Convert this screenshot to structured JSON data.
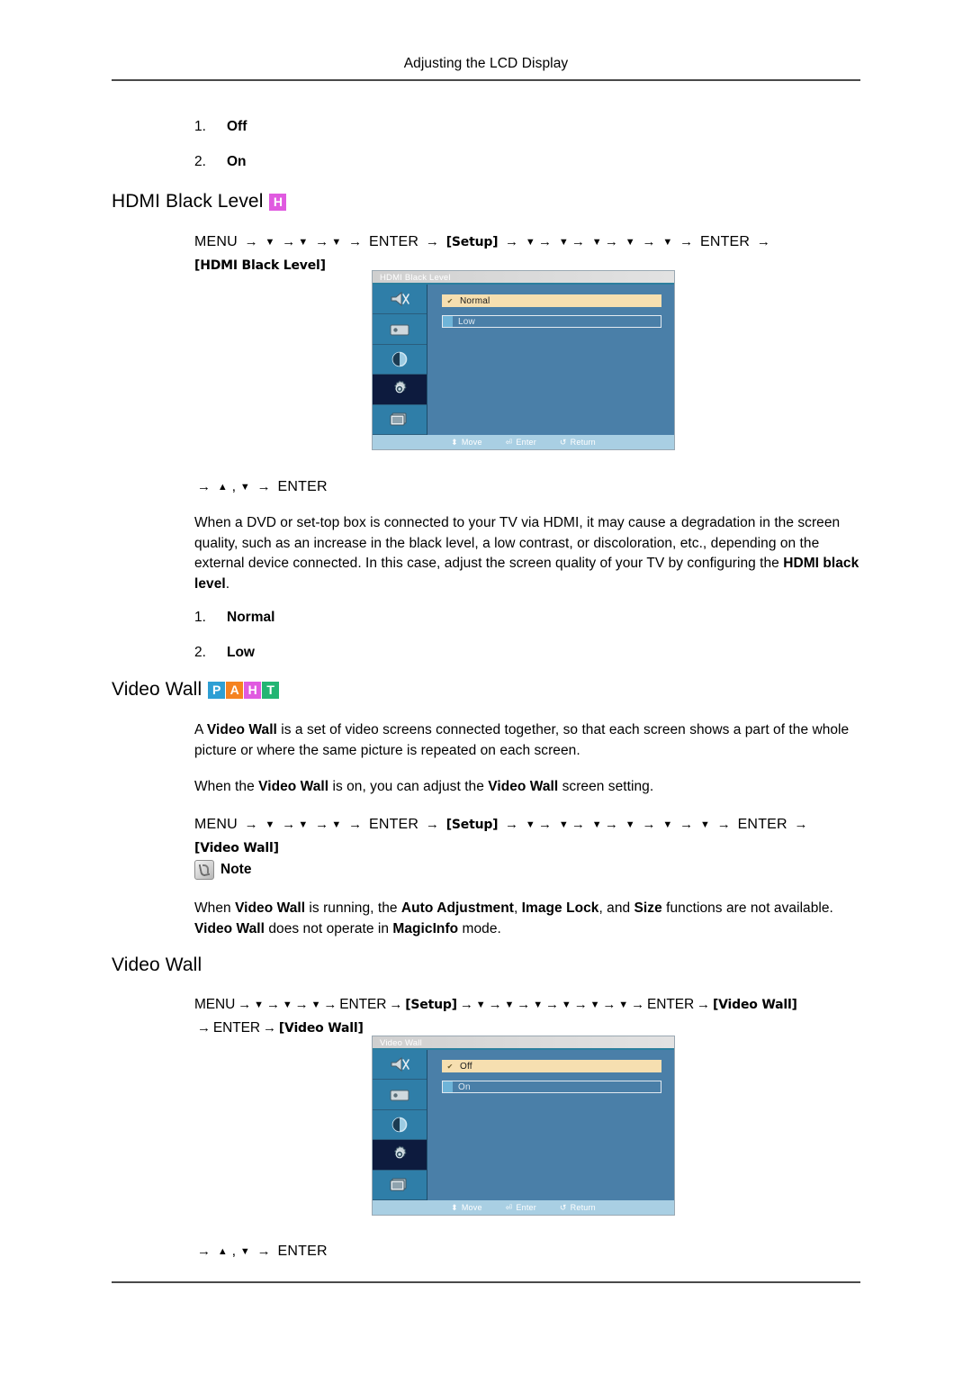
{
  "document": {
    "running_header": "Adjusting the LCD Display"
  },
  "top_list": {
    "items": [
      {
        "num": "1.",
        "label": "Off"
      },
      {
        "num": "2.",
        "label": "On"
      }
    ]
  },
  "hdmi_black_level": {
    "heading": "HDMI Black Level",
    "badges": [
      {
        "letter": "H",
        "color": "#e05ae0"
      }
    ],
    "menu_path": {
      "start": "MENU",
      "enter1": "ENTER",
      "setup": "[Setup]",
      "enter2": "ENTER",
      "target": "[HDMI Black Level]",
      "down_arrow": "▼",
      "arrow": "→"
    },
    "osd": {
      "title": "HDMI Black Level",
      "options": [
        {
          "label": "Normal",
          "selected": true,
          "check": "✔"
        },
        {
          "label": "Low",
          "selected": false
        }
      ],
      "footer": [
        {
          "icon": "move-icon",
          "glyph": "⬍",
          "label": "Move"
        },
        {
          "icon": "enter-icon",
          "glyph": "⏎",
          "label": "Enter"
        },
        {
          "icon": "return-icon",
          "glyph": "↺",
          "label": "Return"
        }
      ],
      "sidebar_icons": [
        "sound-icon",
        "picture-icon",
        "contrast-icon",
        "setup-gear-icon",
        "multi-control-icon"
      ],
      "selected_sidebar_index": 3
    },
    "key_hint": {
      "arrow": "→",
      "up": "▲",
      "comma": ",",
      "down": "▼",
      "enter": "ENTER"
    },
    "description": {
      "line1_a": "When a DVD or set-top box is connected to your TV via HDMI, it may cause a degradation in the screen quality, such as an increase in the black level, a low contrast, or discoloration, etc., depending on the external device connected. In this case, adjust the screen quality of your TV by configuring the ",
      "line1_bold": "HDMI black level",
      "line1_b": "."
    },
    "options_list": [
      {
        "num": "1.",
        "label": "Normal"
      },
      {
        "num": "2.",
        "label": "Low"
      }
    ]
  },
  "video_wall": {
    "heading": "Video Wall",
    "badges": [
      {
        "letter": "P",
        "color": "#2e9fd4"
      },
      {
        "letter": "A",
        "color": "#f58220"
      },
      {
        "letter": "H",
        "color": "#e05ae0"
      },
      {
        "letter": "T",
        "color": "#22b573"
      }
    ],
    "para1": {
      "a": "A ",
      "b1": "Video Wall",
      "b": " is a set of video screens connected together, so that each screen shows a part of the whole picture or where the same picture is repeated on each screen."
    },
    "para2": {
      "a": "When the ",
      "b1": "Video Wall",
      "b": " is on, you can adjust the ",
      "b2": "Video Wall",
      "c": " screen setting."
    },
    "menu_path": {
      "start": "MENU",
      "enter1": "ENTER",
      "setup": "[Setup]",
      "enter2": "ENTER",
      "target": "[Video Wall]",
      "down_arrow": "▼",
      "arrow": "→"
    },
    "note": {
      "label": "Note",
      "icon": "note-hand-icon",
      "text_a": "When ",
      "text_b1": "Video Wall",
      "text_b": " is running, the ",
      "text_b2": "Auto Adjustment",
      "text_c": ", ",
      "text_b3": "Image Lock",
      "text_d": ", and ",
      "text_b4": "Size",
      "text_e": " functions are not available. ",
      "text_b5": "Video Wall",
      "text_f": " does not operate in ",
      "text_b6": "MagicInfo",
      "text_g": " mode."
    }
  },
  "video_wall_sub": {
    "heading": "Video Wall",
    "menu_path": {
      "start": "MENU",
      "enter1": "ENTER",
      "setup": "[Setup]",
      "enter2": "ENTER",
      "target1": "[Video Wall]",
      "enter3": "ENTER",
      "target2": "[Video Wall]",
      "down_arrow": "▼",
      "arrow": "→"
    },
    "osd": {
      "title": "Video Wall",
      "options": [
        {
          "label": "Off",
          "selected": true,
          "check": "✔"
        },
        {
          "label": "On",
          "selected": false
        }
      ],
      "footer": [
        {
          "icon": "move-icon",
          "glyph": "⬍",
          "label": "Move"
        },
        {
          "icon": "enter-icon",
          "glyph": "⏎",
          "label": "Enter"
        },
        {
          "icon": "return-icon",
          "glyph": "↺",
          "label": "Return"
        }
      ],
      "sidebar_icons": [
        "sound-icon",
        "picture-icon",
        "contrast-icon",
        "setup-gear-icon",
        "multi-control-icon"
      ],
      "selected_sidebar_index": 3
    },
    "key_hint": {
      "arrow": "→",
      "up": "▲",
      "comma": ",",
      "down": "▼",
      "enter": "ENTER"
    }
  }
}
